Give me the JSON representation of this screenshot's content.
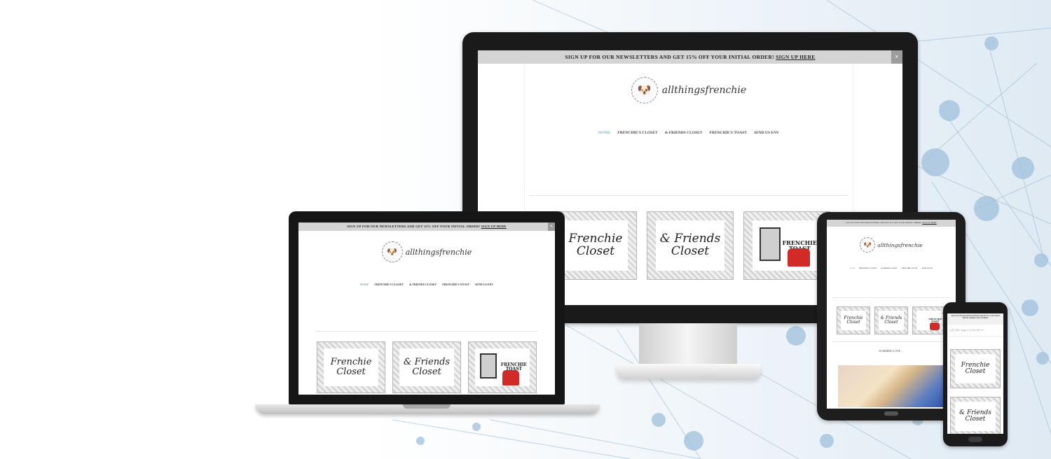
{
  "site": {
    "banner_text": "SIGN UP FOR OUR NEWSLETTERS AND GET 15% OFF YOUR INITIAL ORDER!",
    "banner_link": "SIGN UP HERE",
    "close_label": "×",
    "logo_text": "allthingsfrenchie",
    "nav": [
      "HOME",
      "FRENCHIE'S CLOSET",
      "& FRIENDS CLOSET",
      "FRENCHIE'S TOAST",
      "SEND US ENV"
    ],
    "frames": [
      {
        "line1": "Frenchie",
        "line2": "Closet"
      },
      {
        "line1": "& Friends",
        "line2": "Closet"
      },
      {
        "line1": "FRENCHIE",
        "line2": "TOAST"
      }
    ],
    "section_heading": "SUMMER LOVE ...",
    "phone_logo_text": "allthingsfrenchie"
  },
  "colors": {
    "nav_active": "#7fb7c9",
    "banner_bg": "#d4d4d4",
    "accent_red": "#c8332f"
  }
}
